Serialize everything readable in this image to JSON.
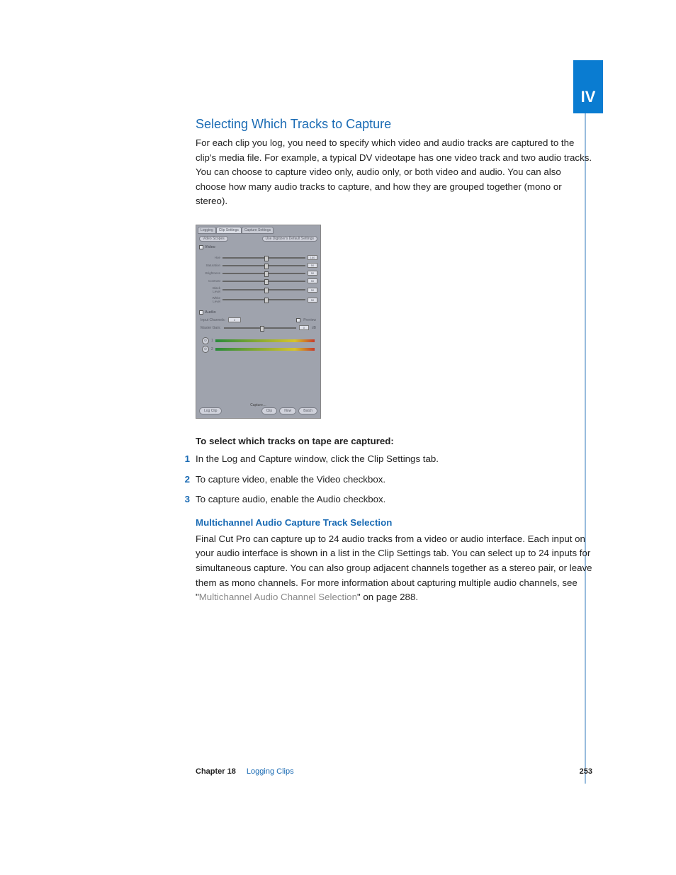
{
  "part_tab": "IV",
  "heading": "Selecting Which Tracks to Capture",
  "intro": "For each clip you log, you need to specify which video and audio tracks are captured to the clip's media file. For example, a typical DV videotape has one video track and two audio tracks. You can choose to capture video only, audio only, or both video and audio. You can also choose how many audio tracks to capture, and how they are grouped together (mono or stereo).",
  "screenshot": {
    "tabs": [
      "Logging",
      "Clip Settings",
      "Capture Settings"
    ],
    "active_tab": 1,
    "btn_videoscopes": "Video Scopes",
    "btn_defaults": "Use Digitizer's Default Settings",
    "video_label": "Video",
    "sliders": [
      {
        "label": "Hue",
        "value": "180"
      },
      {
        "label": "Saturation",
        "value": "50"
      },
      {
        "label": "Brightness",
        "value": "50"
      },
      {
        "label": "Contrast",
        "value": "50"
      },
      {
        "label": "Black Level",
        "value": "50"
      },
      {
        "label": "White Level",
        "value": "50"
      }
    ],
    "audio_label": "Audio",
    "input_channels_label": "Input Channels:",
    "input_channels_value": "2",
    "preview_label": "Preview",
    "gain_label": "Master Gain:",
    "gain_value": "0",
    "db_unit": "dB",
    "meter_labels": [
      "1",
      "2"
    ],
    "capture_label": "Capture…",
    "btn_logclip": "Log Clip",
    "btn_clip": "Clip",
    "btn_now": "Now",
    "btn_batch": "Batch"
  },
  "instructions_head": "To select which tracks on tape are captured:",
  "steps": [
    "In the Log and Capture window, click the Clip Settings tab.",
    "To capture video, enable the Video checkbox.",
    "To capture audio, enable the Audio checkbox."
  ],
  "subhead": "Multichannel Audio Capture Track Selection",
  "multichannel_before": "Final Cut Pro can capture up to 24 audio tracks from a video or audio interface. Each input on your audio interface is shown in a list in the Clip Settings tab. You can select up to 24 inputs for simultaneous capture. You can also group adjacent channels together as a stereo pair, or leave them as mono channels. For more information about capturing multiple audio channels, see \"",
  "multichannel_link": "Multichannel Audio Channel Selection",
  "multichannel_after": "\" on page 288.",
  "footer": {
    "chapter_label": "Chapter 18",
    "chapter_title": "Logging Clips",
    "page_number": "253"
  }
}
